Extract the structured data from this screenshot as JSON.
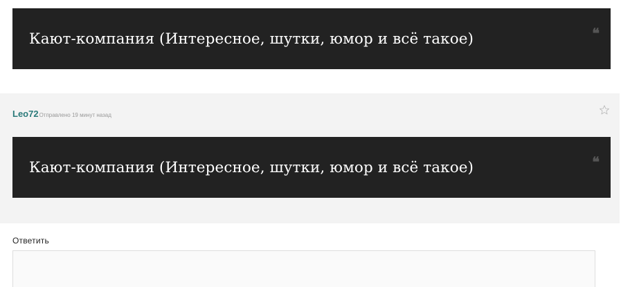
{
  "top_quote": {
    "text": "Кают-компания (Интересное, шутки, юмор и всё такое)",
    "icon": "quote-icon"
  },
  "post": {
    "author": "Leo72",
    "posted": "Отправлено 19 минут назад",
    "favorite_icon": "star-icon",
    "quote": {
      "text": "Кают-компания (Интересное, шутки, юмор и всё такое)",
      "icon": "quote-icon"
    }
  },
  "reply": {
    "label": "Ответить",
    "value": "",
    "placeholder": ""
  },
  "colors": {
    "quote_background": "#222222",
    "author_link": "#2a7a7a",
    "post_background": "#f3f3f3"
  }
}
